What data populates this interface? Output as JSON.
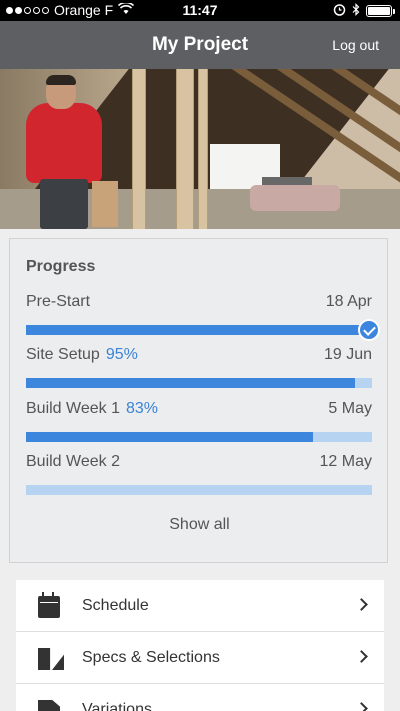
{
  "status_bar": {
    "carrier": "Orange F",
    "time": "11:47"
  },
  "header": {
    "title": "My Project",
    "logout_label": "Log out"
  },
  "progress": {
    "heading": "Progress",
    "stages": [
      {
        "name": "Pre-Start",
        "percent_label": "",
        "date": "18 Apr",
        "progress": 1.0,
        "completed": true
      },
      {
        "name": "Site Setup",
        "percent_label": "95%",
        "date": "19 Jun",
        "progress": 0.95,
        "completed": false
      },
      {
        "name": "Build Week 1",
        "percent_label": "83%",
        "date": "5 May",
        "progress": 0.83,
        "completed": false
      },
      {
        "name": "Build Week 2",
        "percent_label": "",
        "date": "12 May",
        "progress": 0.0,
        "completed": false
      }
    ],
    "show_all_label": "Show all"
  },
  "menu": {
    "items": [
      {
        "label": "Schedule",
        "icon": "calendar-icon"
      },
      {
        "label": "Specs & Selections",
        "icon": "swatch-icon"
      },
      {
        "label": "Variations",
        "icon": "document-icon"
      }
    ]
  },
  "colors": {
    "accent": "#3d86de",
    "bar_track": "#b6d3f2",
    "nav": "#5d5f62"
  }
}
